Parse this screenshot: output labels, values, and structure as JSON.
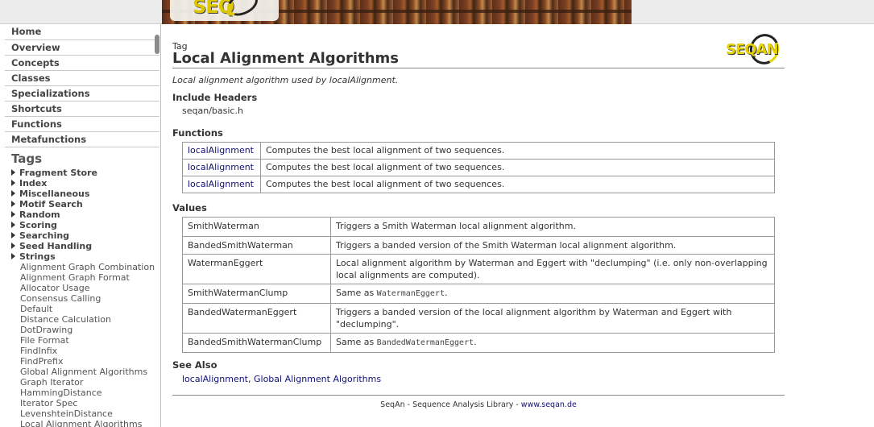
{
  "sidebar": {
    "nav": [
      "Home",
      "Overview",
      "Concepts",
      "Classes",
      "Specializations",
      "Shortcuts",
      "Functions",
      "Metafunctions"
    ],
    "tags_title": "Tags",
    "tag_categories": [
      "Fragment Store",
      "Index",
      "Miscellaneous",
      "Motif Search",
      "Random",
      "Scoring",
      "Searching",
      "Seed Handling",
      "Strings"
    ],
    "tag_items": [
      "Alignment Graph Combination",
      "Alignment Graph Format",
      "Allocator Usage",
      "Consensus Calling",
      "Default",
      "Distance Calculation",
      "DotDrawing",
      "File Format",
      "FindInfix",
      "FindPrefix",
      "Global Alignment Algorithms",
      "Graph Iterator",
      "HammingDistance",
      "Iterator Spec",
      "LevenshteinDistance",
      "Local Alignment Algorithms"
    ]
  },
  "page": {
    "kind": "Tag",
    "title": "Local Alignment Algorithms",
    "brief": "Local alignment algorithm used by localAlignment.",
    "logo_text": "SEQAN"
  },
  "include": {
    "heading": "Include Headers",
    "file": "seqan/basic.h"
  },
  "functions": {
    "heading": "Functions",
    "rows": [
      {
        "name": "localAlignment",
        "desc": "Computes the best local alignment of two sequences."
      },
      {
        "name": "localAlignment",
        "desc": "Computes the best local alignment of two sequences."
      },
      {
        "name": "localAlignment",
        "desc": "Computes the best local alignment of two sequences."
      }
    ]
  },
  "values": {
    "heading": "Values",
    "rows": [
      {
        "name": "SmithWaterman",
        "desc": "Triggers a Smith Waterman local alignment algorithm."
      },
      {
        "name": "BandedSmithWaterman",
        "desc": "Triggers a banded version of the Smith Waterman local alignment algorithm."
      },
      {
        "name": "WatermanEggert",
        "desc": "Local alignment algorithm by Waterman and Eggert with \"declumping\" (i.e. only non-overlapping local alignments are computed)."
      },
      {
        "name": "SmithWatermanClump",
        "desc_prefix": "Same as ",
        "desc_code": "WatermanEggert",
        "desc_suffix": "."
      },
      {
        "name": "BandedWatermanEggert",
        "desc": "Triggers a banded version of the local alignment algorithm by Waterman and Eggert with \"declumping\"."
      },
      {
        "name": "BandedSmithWatermanClump",
        "desc_prefix": "Same as ",
        "desc_code": "BandedWatermanEggert",
        "desc_suffix": "."
      }
    ]
  },
  "see_also": {
    "heading": "See Also",
    "link1": "localAlignment",
    "separator": ", ",
    "link2": "Global Alignment Algorithms"
  },
  "footer": {
    "text": "SeqAn - Sequence Analysis Library - ",
    "link": "www.seqan.de"
  }
}
